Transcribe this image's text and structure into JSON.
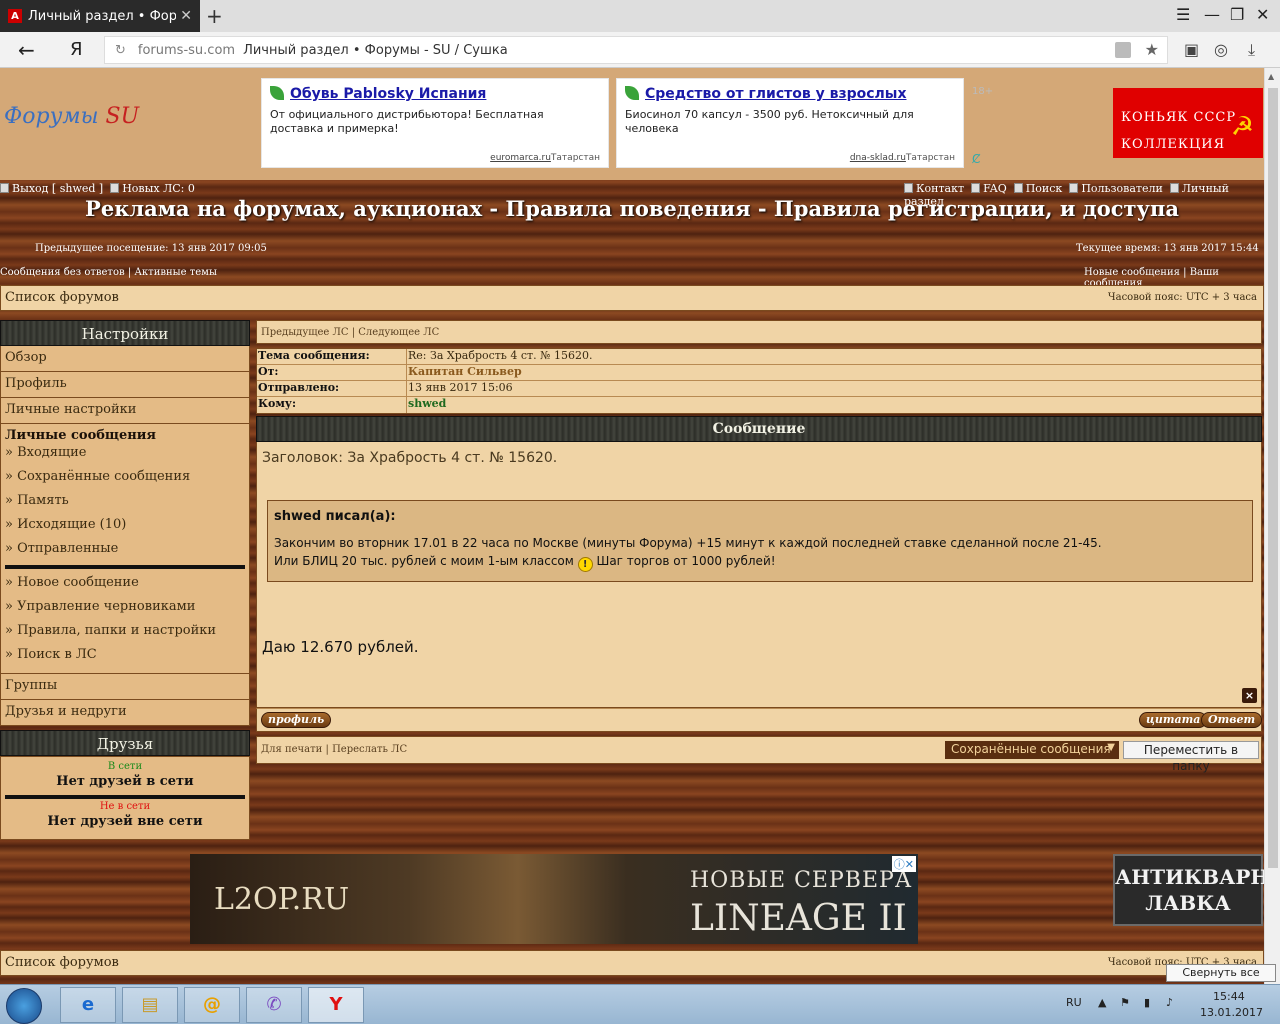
{
  "browser": {
    "tab_title": "Личный раздел • Форумы",
    "favicon_letter": "A",
    "new_tab": "+",
    "url_domain": "forums-su.com",
    "url_title": "Личный раздел • Форумы - SU / Сушка",
    "nav_ya": "Я"
  },
  "header": {
    "logo_main": "Форумы",
    "logo_su": "SU",
    "ads": [
      {
        "title": "Обувь Pablosky Испания",
        "text": "От официального дистрибьютора! Бесплатная доставка и примерка!",
        "source": "euromarca.ru",
        "region": "Татарстан"
      },
      {
        "title": "Средство от глистов у взрослых",
        "text": "Биосинол 70 капсул - 3500 руб. Нетоксичный для человека",
        "source": "dna-sklad.ru",
        "region": "Татарстан"
      }
    ],
    "age_mark": "18+",
    "cognac_line1": "КОНЬЯК СССР",
    "cognac_line2": "КОЛЛЕКЦИЯ"
  },
  "toplinks": {
    "logout": "Выход [ shwed ]",
    "new_pm": "Новых ЛС: 0",
    "contact": "Контакт",
    "faq": "FAQ",
    "search": "Поиск",
    "users": "Пользователи",
    "personal": "Личный раздел"
  },
  "site_title": "Реклама на форумах, аукционах - Правила поведения - Правила регистрации, и доступа",
  "visit": {
    "prev": "Предыдущее посещение: 13 янв 2017 09:05",
    "now": "Текущее время: 13 янв 2017 15:44"
  },
  "links2": {
    "unanswered": "Сообщения без ответов",
    "active": "Активные темы",
    "new_msgs": "Новые сообщения",
    "your_msgs": "Ваши сообщения",
    "sep": "|"
  },
  "breadcrumb": {
    "forum_list": "Список форумов",
    "timezone": "Часовой пояс: UTC + 3 часа"
  },
  "sidebar": {
    "settings_header": "Настройки",
    "overview": "Обзор",
    "profile": "Профиль",
    "personal_settings": "Личные настройки",
    "pm_title": "Личные сообщения",
    "pm_items": [
      "» Входящие",
      "» Сохранённые сообщения",
      "» Память",
      "» Исходящие (10)",
      "» Отправленные"
    ],
    "pm_items2": [
      "» Новое сообщение",
      "» Управление черновиками",
      "» Правила, папки и настройки",
      "» Поиск в ЛС"
    ],
    "groups": "Группы",
    "friends_foes": "Друзья и недруги",
    "friends_header": "Друзья",
    "online": "В сети",
    "no_online": "Нет друзей в сети",
    "offline": "Не в сети",
    "no_offline": "Нет друзей вне сети"
  },
  "main": {
    "prev_pm": "Предыдущее ЛС",
    "next_pm": "Следующее ЛС",
    "sep": "|",
    "meta": [
      {
        "k": "Тема сообщения:",
        "v": "Re: За Храбрость 4 ст. № 15620."
      },
      {
        "k": "От:",
        "v": "Капитан Сильвер"
      },
      {
        "k": "Отправлено:",
        "v": "13 янв 2017 15:06"
      },
      {
        "k": "Кому:",
        "v": "shwed"
      }
    ],
    "msg_header": "Сообщение",
    "subject_line": "Заголовок: За Храбрость 4 ст. № 15620.",
    "quote_author": "shwed писал(а):",
    "quote_line1": "Закончим во вторник 17.01 в 22 часа по Москве (минуты Форума) +15 минут к каждой последней ставке сделанной после 21-45.",
    "quote_line2a": "Или БЛИЦ 20 тыс. рублей с моим 1-ым классом",
    "quote_line2b": "Шаг торгов от 1000 рублей!",
    "smile": "!",
    "bid": "Даю 12.670 рублей.",
    "profile_btn": "профиль",
    "quote_btn": "цитата",
    "reply_btn": "Ответ",
    "del": "×",
    "print": "Для печати",
    "forward": "Переслать ЛС",
    "folder_select": "Сохранённые сообщения",
    "move_btn": "Переместить в папку"
  },
  "footer": {
    "banner_logo": "L2OP.RU",
    "banner_t1": "НОВЫЕ СЕРВЕРА",
    "banner_t2": "LINEAGE II",
    "antique1": "АНТИКВАРНАЯ",
    "antique2": "ЛАВКА",
    "forum_list": "Список форумов",
    "timezone": "Часовой пояс: UTC + 3 часа",
    "tooltip": "Свернуть все окна"
  },
  "taskbar": {
    "lang": "RU",
    "time": "15:44",
    "date": "13.01.2017",
    "yandex": "Y"
  }
}
